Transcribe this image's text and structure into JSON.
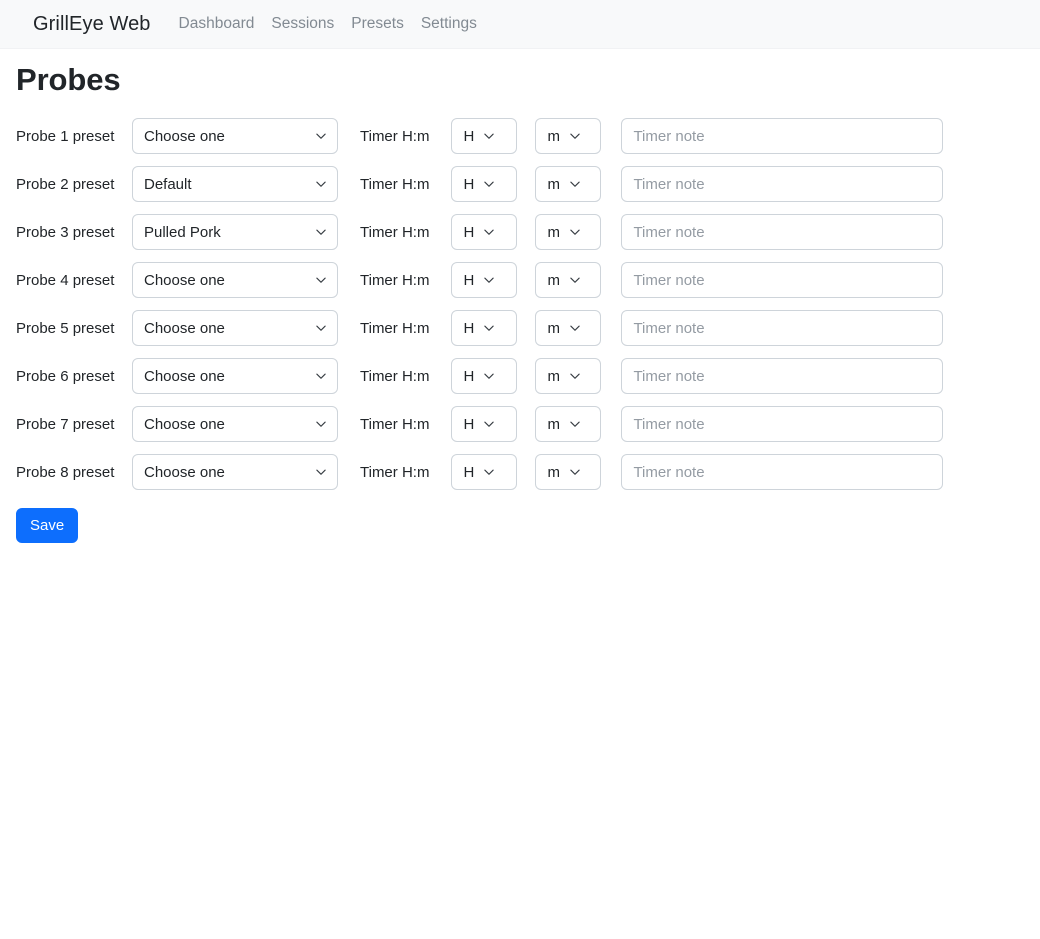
{
  "navbar": {
    "brand": "GrillEye Web",
    "links": [
      {
        "label": "Dashboard",
        "name": "nav-link-dashboard"
      },
      {
        "label": "Sessions",
        "name": "nav-link-sessions"
      },
      {
        "label": "Presets",
        "name": "nav-link-presets"
      },
      {
        "label": "Settings",
        "name": "nav-link-settings"
      }
    ]
  },
  "page": {
    "title": "Probes"
  },
  "form": {
    "timer_label": "Timer H:m",
    "hour_select_value": "H",
    "minute_select_value": "m",
    "note_placeholder": "Timer note",
    "caret_icon": "chevron-down-icon",
    "rows": [
      {
        "label": "Probe 1 preset",
        "preset": "Choose one",
        "hour": "H",
        "minute": "m",
        "note": "",
        "note_placeholder": "Timer note"
      },
      {
        "label": "Probe 2 preset",
        "preset": "Default",
        "hour": "H",
        "minute": "m",
        "note": "",
        "note_placeholder": "Timer note"
      },
      {
        "label": "Probe 3 preset",
        "preset": "Pulled Pork",
        "hour": "H",
        "minute": "m",
        "note": "",
        "note_placeholder": "Timer note"
      },
      {
        "label": "Probe 4 preset",
        "preset": "Choose one",
        "hour": "H",
        "minute": "m",
        "note": "",
        "note_placeholder": "Timer note"
      },
      {
        "label": "Probe 5 preset",
        "preset": "Choose one",
        "hour": "H",
        "minute": "m",
        "note": "",
        "note_placeholder": "Timer note"
      },
      {
        "label": "Probe 6 preset",
        "preset": "Choose one",
        "hour": "H",
        "minute": "m",
        "note": "",
        "note_placeholder": "Timer note"
      },
      {
        "label": "Probe 7 preset",
        "preset": "Choose one",
        "hour": "H",
        "minute": "m",
        "note": "",
        "note_placeholder": "Timer note"
      },
      {
        "label": "Probe 8 preset",
        "preset": "Choose one",
        "hour": "H",
        "minute": "m",
        "note": "",
        "note_placeholder": "Timer note"
      }
    ],
    "save_label": "Save"
  },
  "colors": {
    "navbar_bg": "#f8f9fa",
    "primary": "#0d6efd",
    "border": "#ced4da",
    "muted_text": "#828a92",
    "placeholder": "#949ba3",
    "text": "#212529"
  }
}
